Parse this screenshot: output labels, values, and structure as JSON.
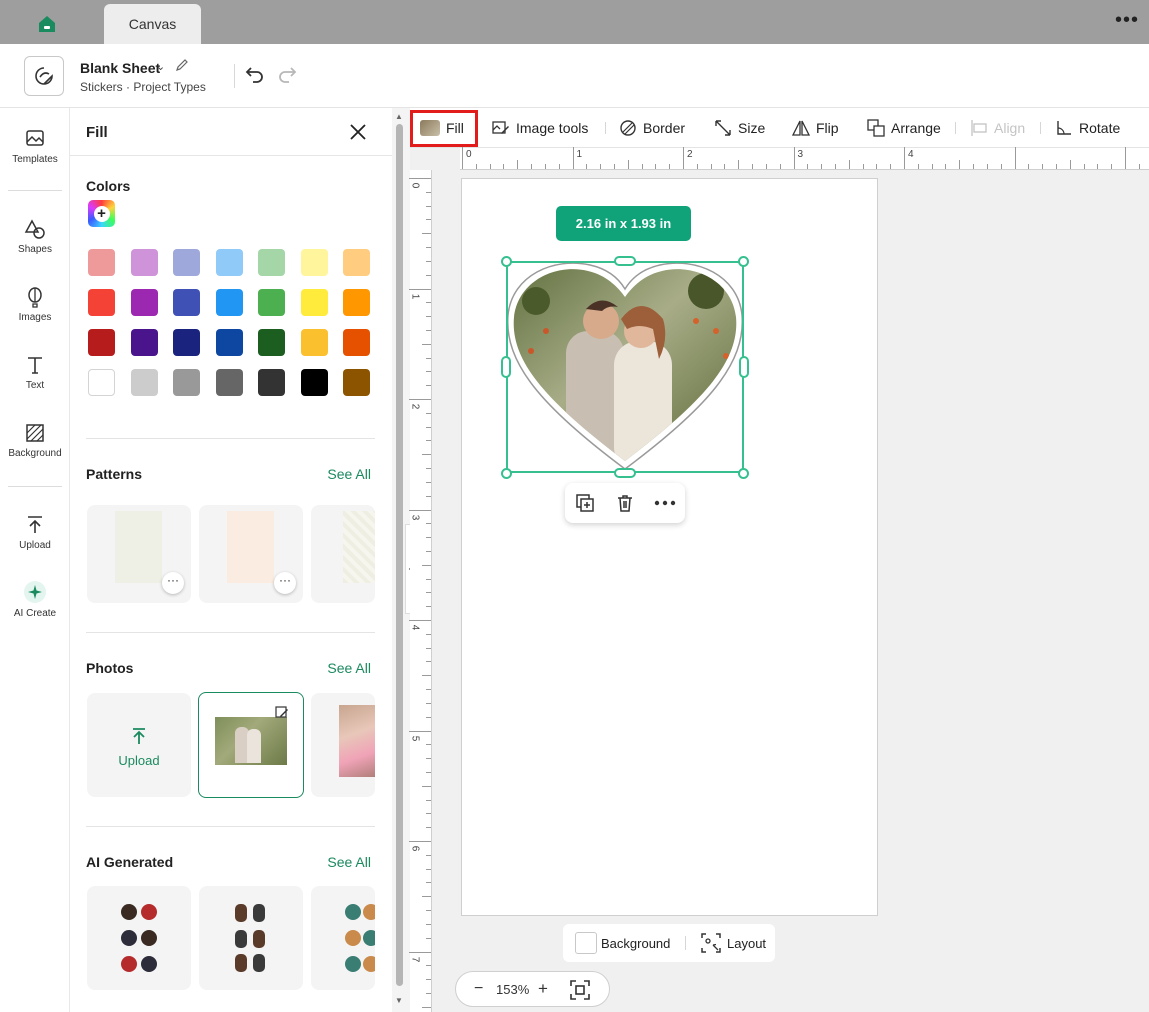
{
  "topbar": {
    "tab_label": "Canvas",
    "more_label": "•••"
  },
  "header": {
    "project_title": "Blank Sheet",
    "project_subtitle": "Stickers · Project Types"
  },
  "leftnav": {
    "templates": "Templates",
    "shapes": "Shapes",
    "images": "Images",
    "text": "Text",
    "background": "Background",
    "upload": "Upload",
    "ai_create": "AI Create"
  },
  "panel": {
    "title": "Fill",
    "colors_title": "Colors",
    "color_add_symbol": "+",
    "swatch_rows": [
      [
        "#ef9a9a",
        "#ce93d8",
        "#9fa8da",
        "#90caf9",
        "#a5d6a7",
        "#fff59d",
        "#ffcc80"
      ],
      [
        "#f44336",
        "#9c27b0",
        "#3f51b5",
        "#2196f3",
        "#4caf50",
        "#ffeb3b",
        "#ff9800"
      ],
      [
        "#b71c1c",
        "#4a148c",
        "#1a237e",
        "#0d47a1",
        "#1b5e20",
        "#fbc02d",
        "#e65100"
      ],
      [
        "#ffffff",
        "#cccccc",
        "#999999",
        "#666666",
        "#333333",
        "#000000",
        "#8d5400"
      ]
    ],
    "patterns_title": "Patterns",
    "photos_title": "Photos",
    "ai_title": "AI Generated",
    "see_all": "See All",
    "upload_label": "Upload",
    "more_dots": "···"
  },
  "toolbar": {
    "fill": "Fill",
    "image_tools": "Image tools",
    "border": "Border",
    "size": "Size",
    "flip": "Flip",
    "arrange": "Arrange",
    "align": "Align",
    "rotate": "Rotate"
  },
  "rulers": {
    "top": [
      "0",
      "1",
      "2",
      "3",
      "4"
    ],
    "left": [
      "0",
      "1",
      "2",
      "3",
      "4",
      "5",
      "6",
      "7"
    ]
  },
  "canvas": {
    "size_badge": "2.16  in x 1.93  in",
    "background_label": "Background",
    "layout_label": "Layout",
    "zoom": "153%",
    "zoom_minus": "−",
    "zoom_plus": "+"
  },
  "colors": {
    "accent": "#1a8a5f",
    "selection": "#36c08f",
    "badge": "#10a37a",
    "highlight": "#e21b1b"
  }
}
